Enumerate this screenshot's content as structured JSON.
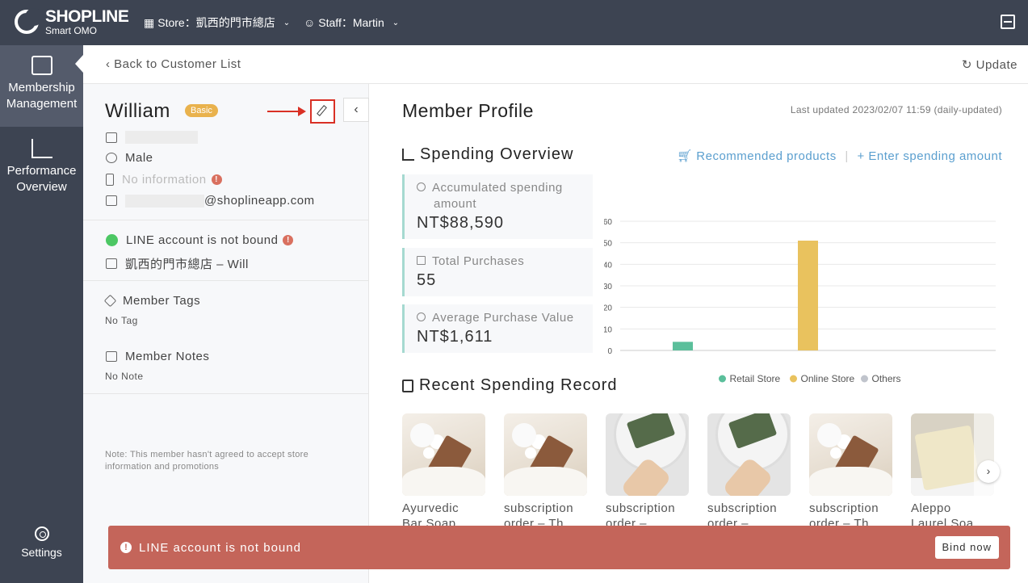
{
  "brand": {
    "name": "SHOPLINE",
    "sub": "Smart OMO"
  },
  "topbar": {
    "store_label": "Store：凱西的門市總店",
    "staff_label": "Staff：Martin"
  },
  "sidebar": {
    "items": [
      {
        "line1": "Membership",
        "line2": "Management",
        "icon": "member-card-icon",
        "active": true
      },
      {
        "line1": "Performance",
        "line2": "Overview",
        "icon": "chart-icon",
        "active": false
      }
    ],
    "settings": "Settings"
  },
  "header": {
    "back": "Back to Customer List",
    "update": "Update"
  },
  "member": {
    "name": "William",
    "tier": "Basic",
    "email_suffix": "@shoplineapp.com",
    "gender": "Male",
    "phone": "No information",
    "line_status": "LINE account is not bound",
    "store_staff": "凱西的門市總店 – Will",
    "tags_title": "Member Tags",
    "tags_value": "No Tag",
    "notes_title": "Member Notes",
    "notes_value": "No Note",
    "note": "Note: This member hasn't agreed to accept store information and promotions"
  },
  "profile": {
    "title": "Member Profile",
    "last_updated": "Last updated 2023/02/07 11:59 (daily-updated)",
    "overview_title": "Spending Overview",
    "link_recommended": "Recommended products",
    "link_enter": "+ Enter spending amount",
    "stats": [
      {
        "label_line1": "Accumulated spending",
        "label_line2": "amount",
        "value": "NT$88,590"
      },
      {
        "label": "Total Purchases",
        "value": "55"
      },
      {
        "label": "Average Purchase Value",
        "value": "NT$1,611"
      }
    ],
    "recent_title": "Recent Spending Record"
  },
  "chart_data": {
    "type": "bar",
    "categories": [
      "Retail Store",
      "Online Store",
      "Others"
    ],
    "series": [
      {
        "name": "Retail Store",
        "values": [
          4,
          0,
          0
        ],
        "color": "#5bbf9b"
      },
      {
        "name": "Online Store",
        "values": [
          0,
          51,
          0
        ],
        "color": "#e9c25e"
      },
      {
        "name": "Others",
        "values": [
          0,
          0,
          0
        ],
        "color": "#c0c4cc"
      }
    ],
    "ylim": [
      0,
      60
    ],
    "yticks": [
      0,
      10,
      20,
      30,
      40,
      50,
      60
    ],
    "grid": true,
    "legend": "bottom"
  },
  "products": [
    {
      "line1": "Ayurvedic",
      "line2": "Bar Soap",
      "img": "soap"
    },
    {
      "line1": "subscription",
      "line2": "order – Th",
      "img": "soap"
    },
    {
      "line1": "subscription",
      "line2": "order –",
      "img": "plate"
    },
    {
      "line1": "subscription",
      "line2": "order –",
      "img": "plate"
    },
    {
      "line1": "subscription",
      "line2": "order – Th",
      "img": "soap"
    },
    {
      "line1": "Aleppo",
      "line2": "Laurel Soa...",
      "img": "cream"
    }
  ],
  "alert": {
    "text": "LINE account is not bound",
    "button": "Bind now"
  }
}
